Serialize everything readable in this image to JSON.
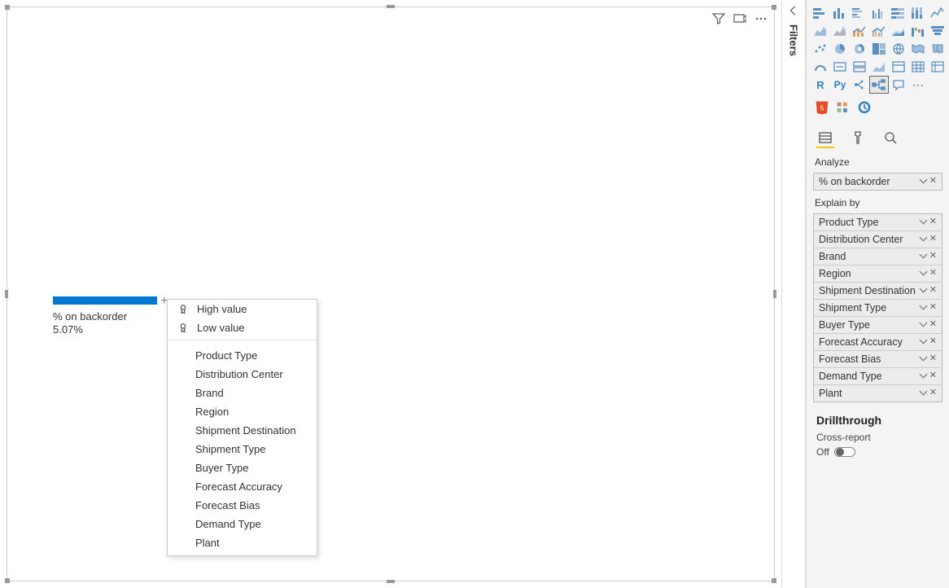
{
  "filters_pane_label": "Filters",
  "canvas": {
    "metric_label": "% on backorder",
    "metric_value": "5.07%"
  },
  "popup": {
    "high_value": "High value",
    "low_value": "Low value",
    "items": [
      "Product Type",
      "Distribution Center",
      "Brand",
      "Region",
      "Shipment Destination",
      "Shipment Type",
      "Buyer Type",
      "Forecast Accuracy",
      "Forecast Bias",
      "Demand Type",
      "Plant"
    ]
  },
  "viz_row5_text": {
    "r": "R",
    "py": "Py"
  },
  "viz_more": "⋯",
  "sections": {
    "analyze_label": "Analyze",
    "analyze_field": "% on backorder",
    "explain_label": "Explain by",
    "explain_fields": [
      "Product Type",
      "Distribution Center",
      "Brand",
      "Region",
      "Shipment Destination",
      "Shipment Type",
      "Buyer Type",
      "Forecast Accuracy",
      "Forecast Bias",
      "Demand Type",
      "Plant"
    ]
  },
  "drillthrough": {
    "heading": "Drillthrough",
    "cross_report": "Cross-report",
    "off": "Off"
  },
  "chart_data": {
    "type": "bar",
    "title": "% on backorder",
    "categories": [
      "% on backorder"
    ],
    "values": [
      5.07
    ],
    "ylabel": "",
    "xlabel": "",
    "ylim": [
      0,
      100
    ]
  }
}
